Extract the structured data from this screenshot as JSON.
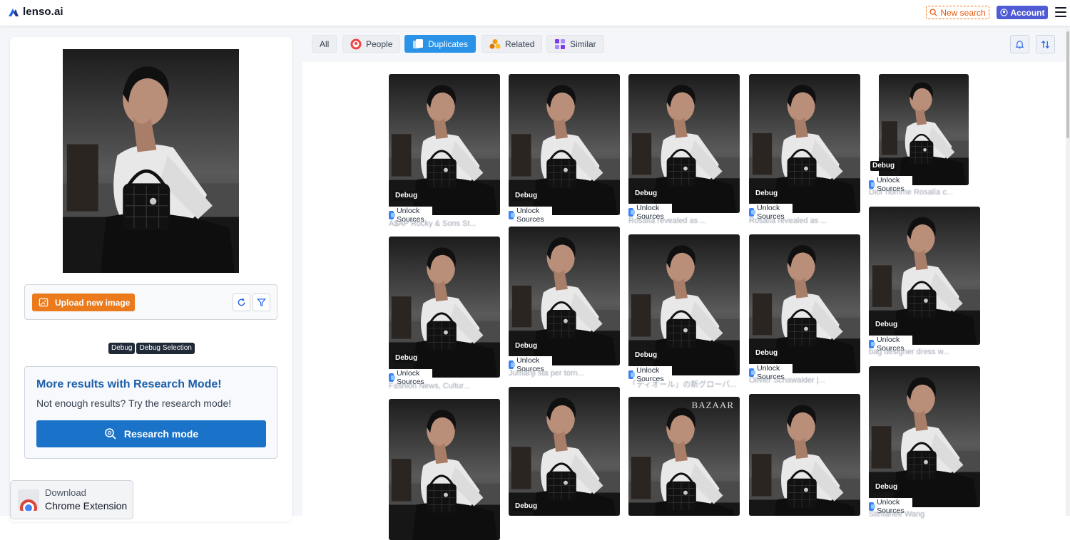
{
  "header": {
    "logo_text": "lenso.ai",
    "new_search_label": "New search",
    "account_label": "Account"
  },
  "left_panel": {
    "upload_label": "Upload new image",
    "debug_tags": [
      "Debug",
      "Debug Selection"
    ],
    "research": {
      "title": "More results with Research Mode!",
      "subtitle": "Not enough results? Try the research mode!",
      "button_label": "Research mode"
    },
    "chrome_ext": {
      "line1": "Download",
      "line2": "Chrome Extension"
    }
  },
  "tabs": [
    {
      "label": "All",
      "icon": "all"
    },
    {
      "label": "People",
      "icon": "people-icon"
    },
    {
      "label": "Duplicates",
      "icon": "duplicates-icon",
      "active": true
    },
    {
      "label": "Related",
      "icon": "related-icon"
    },
    {
      "label": "Similar",
      "icon": "similar-icon"
    }
  ],
  "results": {
    "debug_label": "Debug",
    "unlock_label": "Unlock Sources",
    "items": [
      {
        "title": "A$AP Rocky & Sons St..."
      },
      {
        "title": ""
      },
      {
        "title": "Rosalía revealed as ..."
      },
      {
        "title": "Rosalía revealed as ..."
      },
      {
        "title": "Dior nomme Rosalía c..."
      },
      {
        "title": "Fashion News, Cultur..."
      },
      {
        "title": "Jumanji sta per torn..."
      },
      {
        "title": "「ディオール」の新グローバ..."
      },
      {
        "title": "Olivier Schawalder |..."
      },
      {
        "title": "bag designer dress w..."
      },
      {
        "title": "Steffanee Wang"
      }
    ],
    "watermark": "BAZAAR"
  },
  "colors": {
    "accent_orange": "#ea7a1c",
    "accent_blue": "#1a73c8",
    "tab_active": "#2a93e8",
    "account": "#4f5bd5"
  }
}
